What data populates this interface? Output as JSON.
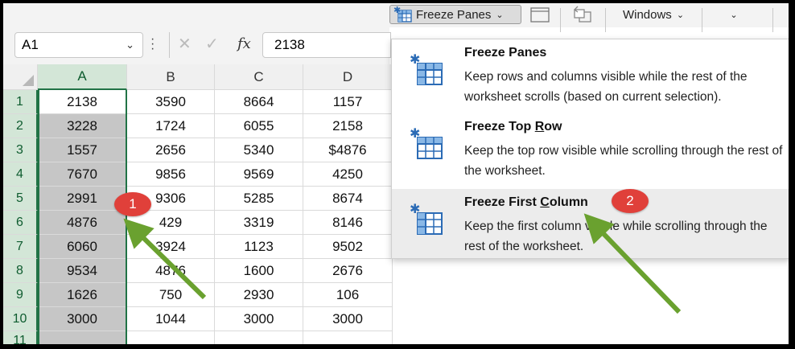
{
  "ribbon": {
    "freeze_panes_label": "Freeze Panes",
    "windows_label": "Windows"
  },
  "formula_bar": {
    "name_box": "A1",
    "fx_label": "fx",
    "formula_value": "2138"
  },
  "grid": {
    "columns": [
      "A",
      "B",
      "C",
      "D"
    ],
    "rows": [
      {
        "row": "1",
        "cells": [
          "2138",
          "3590",
          "8664",
          "1157"
        ]
      },
      {
        "row": "2",
        "cells": [
          "3228",
          "1724",
          "6055",
          "2158"
        ]
      },
      {
        "row": "3",
        "cells": [
          "1557",
          "2656",
          "5340",
          "$4876"
        ]
      },
      {
        "row": "4",
        "cells": [
          "7670",
          "9856",
          "9569",
          "4250"
        ]
      },
      {
        "row": "5",
        "cells": [
          "2991",
          "9306",
          "5285",
          "8674"
        ]
      },
      {
        "row": "6",
        "cells": [
          "4876",
          "429",
          "3319",
          "8146"
        ]
      },
      {
        "row": "7",
        "cells": [
          "6060",
          "3924",
          "1123",
          "9502"
        ]
      },
      {
        "row": "8",
        "cells": [
          "9534",
          "4876",
          "1600",
          "2676"
        ]
      },
      {
        "row": "9",
        "cells": [
          "1626",
          "750",
          "2930",
          "106"
        ]
      },
      {
        "row": "10",
        "cells": [
          "3000",
          "1044",
          "3000",
          "3000"
        ]
      },
      {
        "row": "11",
        "cells": [
          "",
          "",
          "",
          ""
        ]
      }
    ]
  },
  "freeze_menu": {
    "items": [
      {
        "title": "Freeze Panes",
        "description": "Keep rows and columns visible while the rest of the worksheet scrolls (based on current selection).",
        "icon": "freeze-panes-icon"
      },
      {
        "title": "Freeze Top Row",
        "description": "Keep the top row visible while scrolling through the rest of the worksheet.",
        "icon": "freeze-top-row-icon"
      },
      {
        "title": "Freeze First Column",
        "description": "Keep the first column visible while scrolling through the rest of the worksheet.",
        "icon": "freeze-first-column-icon"
      }
    ]
  },
  "annotations": {
    "badge_1": "1",
    "badge_2": "2"
  },
  "colors": {
    "excel_green": "#217346",
    "arrow_green": "#6aa12f",
    "badge_red": "#e0403a"
  }
}
